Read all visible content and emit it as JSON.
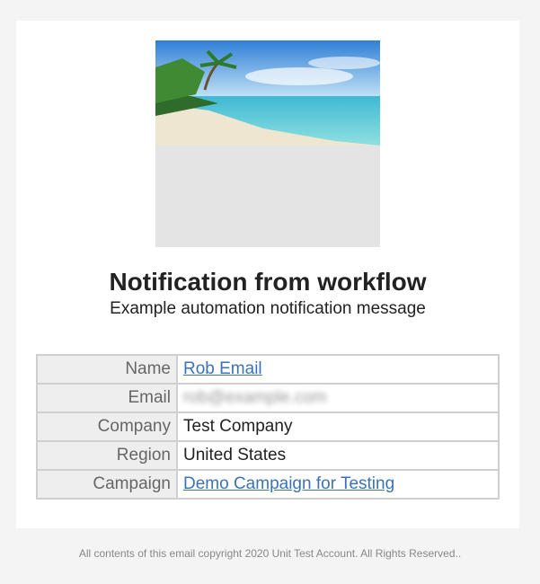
{
  "email": {
    "hero_image": {
      "alt": "beach photo"
    },
    "title": "Notification from workflow",
    "subtitle": "Example automation notification message",
    "rows": [
      {
        "label": "Name",
        "value": "Rob Email",
        "link": true
      },
      {
        "label": "Email",
        "value": "rob@example.com",
        "link": false,
        "blurred": true
      },
      {
        "label": "Company",
        "value": "Test Company",
        "link": false
      },
      {
        "label": "Region",
        "value": "United States",
        "link": false
      },
      {
        "label": "Campaign",
        "value": "Demo Campaign for Testing",
        "link": true
      }
    ],
    "footer": "All contents of this email copyright 2020 Unit Test Account. All Rights Reserved.."
  },
  "colors": {
    "page_bg": "#f4f4f4",
    "card_bg": "#ffffff",
    "label_bg": "#eeeeee",
    "border": "#cfcfcf",
    "link": "#3b73b9"
  }
}
